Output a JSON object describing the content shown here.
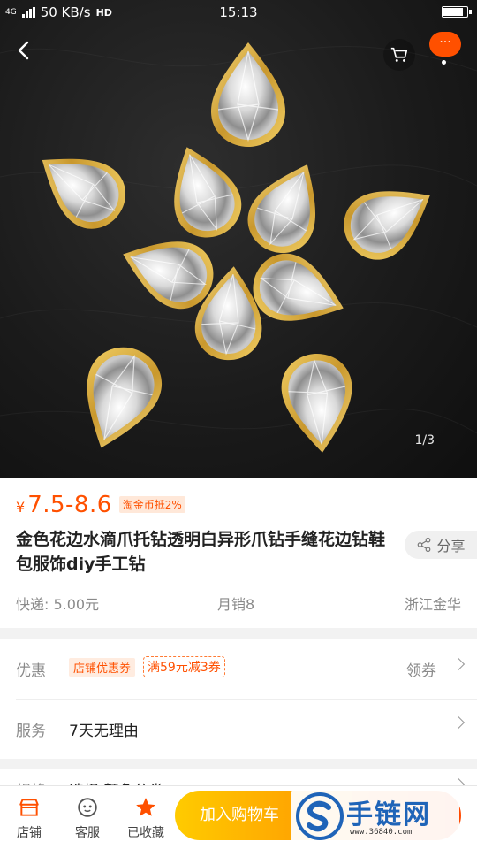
{
  "status_bar": {
    "network": "4G",
    "speed": "50 KB/s",
    "hd": "HD",
    "time": "15:13"
  },
  "header": {
    "back_icon": "chevron-left-icon",
    "cart_icon": "cart-icon",
    "more_label": "···"
  },
  "hero": {
    "image_description": "gold lace-edged teardrop rhinestones on black leather",
    "pager": "1/3"
  },
  "product": {
    "currency": "¥",
    "price": "7.5-8.6",
    "coin_tag": "淘金币抵2%",
    "title": "金色花边水滴爪托钻透明白异形爪钻手缝花边钻鞋包服饰diy手工钻",
    "share_label": "分享",
    "shipping": "快递: 5.00元",
    "monthly_sales": "月销8",
    "location": "浙江金华"
  },
  "promo": {
    "label": "优惠",
    "shop_coupon_tag": "店铺优惠券",
    "discount_tag": "满59元减3券",
    "claim_label": "领券"
  },
  "service": {
    "label": "服务",
    "text": "7天无理由"
  },
  "spec": {
    "label": "规格",
    "text": "选择 颜色分类"
  },
  "bottom_bar": {
    "shop_label": "店铺",
    "service_label": "客服",
    "favorite_label": "已收藏",
    "add_to_cart_label": "加入购物车"
  },
  "watermark": {
    "text": "手链网",
    "url": "www.36840.com"
  },
  "colors": {
    "accent": "#ff5000",
    "cart_button_start": "#ffcb00",
    "cart_button_end": "#ff9402",
    "buy_button": "#ff4900",
    "watermark": "#1f64b8"
  }
}
